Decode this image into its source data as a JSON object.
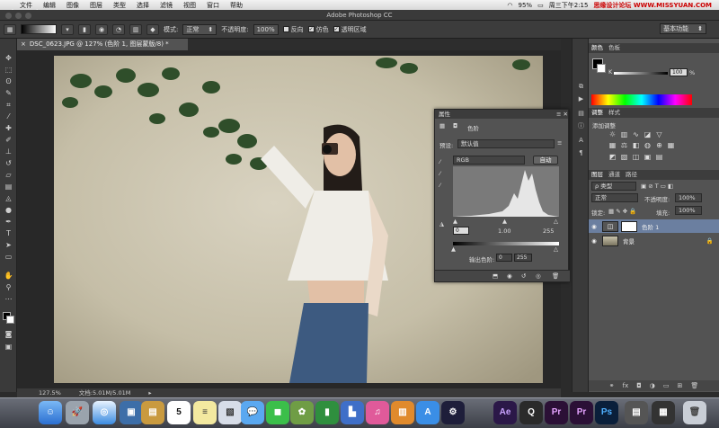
{
  "menubar": {
    "apple": "",
    "app": "Photoshop",
    "items": [
      "文件",
      "编辑",
      "图像",
      "图层",
      "类型",
      "选择",
      "滤镜",
      "视图",
      "窗口",
      "帮助"
    ],
    "battery": "95%",
    "time": "周三下午2:15",
    "watermark": "思缘设计论坛 WWW.MISSYUAN.COM"
  },
  "titlebar": {
    "title": "Adobe Photoshop CC"
  },
  "options": {
    "mode_label": "模式:",
    "mode_value": "正常",
    "opacity_label": "不透明度:",
    "opacity_value": "100%",
    "reverse": "反向",
    "dither": "仿色",
    "transparency": "透明区域",
    "workspace": "基本功能"
  },
  "document": {
    "tab": "DSC_0623.JPG @ 127% (色阶 1, 图层蒙版/8) *"
  },
  "status": {
    "zoom": "127.5%",
    "doc": "文档:5.01M/5.01M"
  },
  "properties": {
    "title": "属性",
    "type": "色阶",
    "preset_label": "预设:",
    "preset_value": "默认值",
    "channel": "RGB",
    "auto": "自动",
    "input_black": "0",
    "input_gamma": "1.00",
    "input_white": "255",
    "output_label": "输出色阶:",
    "output_black": "0",
    "output_white": "255"
  },
  "right": {
    "color_tabs": [
      "颜色",
      "色板"
    ],
    "k_label": "K",
    "k_value": "100",
    "k_unit": "%",
    "adj_tabs": [
      "调整",
      "样式"
    ],
    "adj_title": "添加调整",
    "layer_tabs": [
      "图层",
      "通道",
      "路径"
    ],
    "kind": "ρ 类型",
    "blend": "正常",
    "opacity_label": "不透明度:",
    "opacity_value": "100%",
    "lock_label": "锁定:",
    "fill_label": "填充:",
    "fill_value": "100%",
    "layers": [
      {
        "name": "色阶 1"
      },
      {
        "name": "背景"
      }
    ]
  },
  "dock": {
    "apps": [
      "Finder",
      "Launchpad",
      "Safari",
      "Photos",
      "Notes",
      "Calendar",
      "Stickies",
      "Preview",
      "Messages",
      "FaceTime",
      "Photo",
      "Numbers",
      "Keynote",
      "iTunes",
      "iBooks",
      "App Store",
      "Ae",
      "QuickTime",
      "Pr",
      "Pr",
      "Ps",
      "Trash"
    ],
    "calendar_day": "5",
    "ae": "Ae",
    "pr": "Pr",
    "ps": "Ps"
  }
}
